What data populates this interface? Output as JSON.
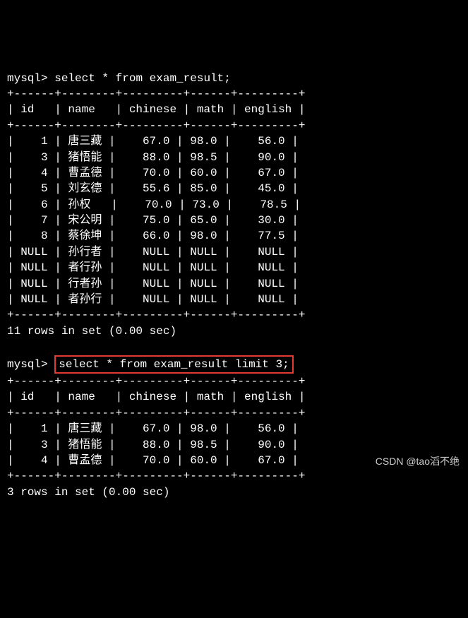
{
  "prompt": "mysql>",
  "query1": "select * from exam_result;",
  "query2": "select * from exam_result limit 3;",
  "border": "+------+--------+---------+------+---------+",
  "header": "| id   | name   | chinese | math | english |",
  "rows1": [
    "|    1 | 唐三藏 |    67.0 | 98.0 |    56.0 |",
    "|    3 | 猪悟能 |    88.0 | 98.5 |    90.0 |",
    "|    4 | 曹孟德 |    70.0 | 60.0 |    67.0 |",
    "|    5 | 刘玄德 |    55.6 | 85.0 |    45.0 |",
    "|    6 | 孙权   |    70.0 | 73.0 |    78.5 |",
    "|    7 | 宋公明 |    75.0 | 65.0 |    30.0 |",
    "|    8 | 蔡徐坤 |    66.0 | 98.0 |    77.5 |",
    "| NULL | 孙行者 |    NULL | NULL |    NULL |",
    "| NULL | 者行孙 |    NULL | NULL |    NULL |",
    "| NULL | 行者孙 |    NULL | NULL |    NULL |",
    "| NULL | 者孙行 |    NULL | NULL |    NULL |"
  ],
  "result1": "11 rows in set (0.00 sec)",
  "rows2": [
    "|    1 | 唐三藏 |    67.0 | 98.0 |    56.0 |",
    "|    3 | 猪悟能 |    88.0 | 98.5 |    90.0 |",
    "|    4 | 曹孟德 |    70.0 | 60.0 |    67.0 |"
  ],
  "result2": "3 rows in set (0.00 sec)",
  "watermark": "CSDN @tao滔不绝",
  "chart_data": {
    "type": "table",
    "title": "exam_result",
    "columns": [
      "id",
      "name",
      "chinese",
      "math",
      "english"
    ],
    "data": [
      {
        "id": 1,
        "name": "唐三藏",
        "chinese": 67.0,
        "math": 98.0,
        "english": 56.0
      },
      {
        "id": 3,
        "name": "猪悟能",
        "chinese": 88.0,
        "math": 98.5,
        "english": 90.0
      },
      {
        "id": 4,
        "name": "曹孟德",
        "chinese": 70.0,
        "math": 60.0,
        "english": 67.0
      },
      {
        "id": 5,
        "name": "刘玄德",
        "chinese": 55.6,
        "math": 85.0,
        "english": 45.0
      },
      {
        "id": 6,
        "name": "孙权",
        "chinese": 70.0,
        "math": 73.0,
        "english": 78.5
      },
      {
        "id": 7,
        "name": "宋公明",
        "chinese": 75.0,
        "math": 65.0,
        "english": 30.0
      },
      {
        "id": 8,
        "name": "蔡徐坤",
        "chinese": 66.0,
        "math": 98.0,
        "english": 77.5
      },
      {
        "id": null,
        "name": "孙行者",
        "chinese": null,
        "math": null,
        "english": null
      },
      {
        "id": null,
        "name": "者行孙",
        "chinese": null,
        "math": null,
        "english": null
      },
      {
        "id": null,
        "name": "行者孙",
        "chinese": null,
        "math": null,
        "english": null
      },
      {
        "id": null,
        "name": "者孙行",
        "chinese": null,
        "math": null,
        "english": null
      }
    ]
  }
}
